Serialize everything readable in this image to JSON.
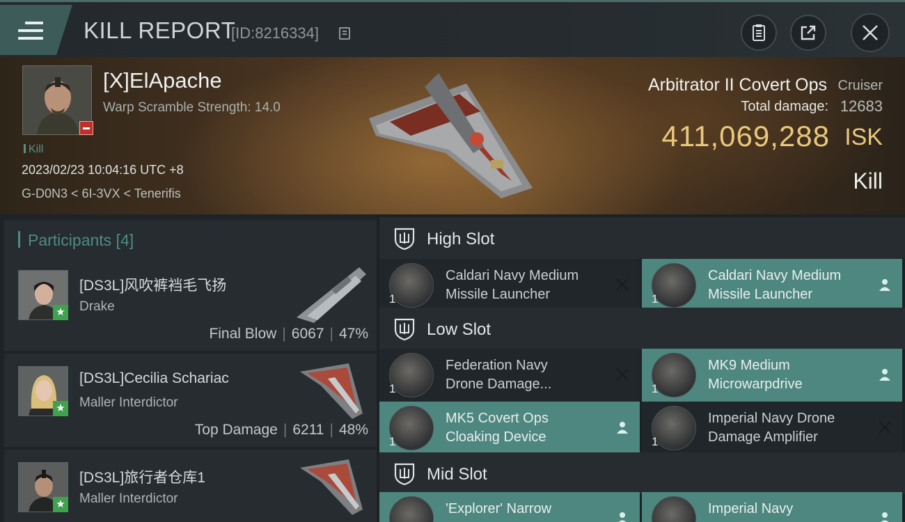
{
  "header": {
    "title": "KILL REPORT",
    "report_id": "[ID:8216334]"
  },
  "victim": {
    "name": "[X]ElApache",
    "warp_scramble": "Warp Scramble Strength: 14.0",
    "kill_tag": "Kill",
    "timestamp": "2023/02/23 10:04:16 UTC +8",
    "location": "G-D0N3 < 6I-3VX < Tenerifis"
  },
  "ship": {
    "name": "Arbitrator II Covert Ops",
    "class": "Cruiser",
    "damage_label": "Total damage:",
    "damage_value": "12683",
    "isk_value": "411,069,288",
    "isk_unit": "ISK",
    "result": "Kill"
  },
  "participants": {
    "heading": "Participants [4]",
    "rows": [
      {
        "name": "[DS3L]风吹裤裆毛飞扬",
        "ship": "Drake",
        "stat_label": "Final Blow",
        "damage": "6067",
        "percent": "47%"
      },
      {
        "name": "[DS3L]Cecilia Schariac",
        "ship": "Maller Interdictor",
        "stat_label": "Top Damage",
        "damage": "6211",
        "percent": "48%"
      },
      {
        "name": "[DS3L]旅行者仓库1",
        "ship": "Maller Interdictor",
        "stat_label": "",
        "damage": "",
        "percent": ""
      }
    ]
  },
  "slots": {
    "high": {
      "label": "High Slot",
      "modules": [
        {
          "line1": "Caldari Navy Medium",
          "line2": "Missile Launcher",
          "qty": "1",
          "status": "destroyed"
        },
        {
          "line1": "Caldari Navy Medium",
          "line2": "Missile Launcher",
          "qty": "1",
          "status": "dropped"
        }
      ]
    },
    "low": {
      "label": "Low Slot",
      "modules": [
        {
          "line1": "Federation Navy",
          "line2": "Drone Damage...",
          "qty": "1",
          "status": "destroyed"
        },
        {
          "line1": "MK9 Medium",
          "line2": "Microwarpdrive",
          "qty": "1",
          "status": "dropped"
        },
        {
          "line1": "MK5 Covert Ops",
          "line2": "Cloaking Device",
          "qty": "1",
          "status": "dropped"
        },
        {
          "line1": "Imperial Navy Drone",
          "line2": "Damage Amplifier",
          "qty": "1",
          "status": "destroyed"
        }
      ]
    },
    "mid": {
      "label": "Mid Slot",
      "modules": [
        {
          "line1": "'Explorer' Narrow",
          "line2": "",
          "qty": "",
          "status": "dropped"
        },
        {
          "line1": "Imperial Navy",
          "line2": "",
          "qty": "",
          "status": "dropped"
        }
      ]
    }
  },
  "icons": {
    "menu": "menu-icon",
    "clipboard": "clipboard-icon",
    "share": "share-icon",
    "close": "close-icon",
    "shield": "shield-slot-icon",
    "destroyed": "x-icon",
    "dropped": "person-icon"
  },
  "colors": {
    "accent": "#4e8780",
    "isk": "#e9c87d",
    "badge_red": "#c0302b",
    "badge_green": "#3fa24f"
  }
}
